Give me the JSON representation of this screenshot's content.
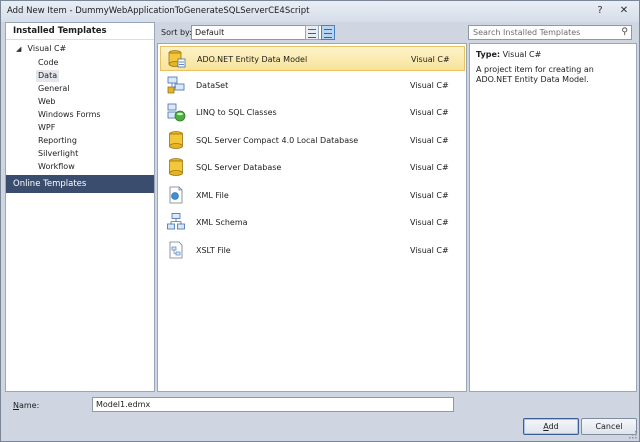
{
  "window": {
    "title": "Add New Item - DummyWebApplicationToGenerateSQLServerCE4Script",
    "help_glyph": "?",
    "close_glyph": "✕"
  },
  "left_panel": {
    "installed_header": "Installed Templates",
    "root": {
      "expander": "◢",
      "label": "Visual C#"
    },
    "children": [
      "Code",
      "Data",
      "General",
      "Web",
      "Windows Forms",
      "WPF",
      "Reporting",
      "Silverlight",
      "Workflow"
    ],
    "selected_child": "Data",
    "online_header": "Online Templates"
  },
  "toolbar": {
    "sort_label": "Sort by:",
    "sort_value": "Default",
    "search_placeholder": "Search Installed Templates",
    "search_icon": "search-icon"
  },
  "templates": [
    {
      "name": "ADO.NET Entity Data Model",
      "lang": "Visual C#",
      "icon": "entity-model-icon",
      "selected": true
    },
    {
      "name": "DataSet",
      "lang": "Visual C#",
      "icon": "dataset-icon"
    },
    {
      "name": "LINQ to SQL Classes",
      "lang": "Visual C#",
      "icon": "linq-icon"
    },
    {
      "name": "SQL Server Compact 4.0 Local Database",
      "lang": "Visual C#",
      "icon": "database-icon"
    },
    {
      "name": "SQL Server Database",
      "lang": "Visual C#",
      "icon": "database-icon"
    },
    {
      "name": "XML File",
      "lang": "Visual C#",
      "icon": "xml-file-icon"
    },
    {
      "name": "XML Schema",
      "lang": "Visual C#",
      "icon": "xml-schema-icon"
    },
    {
      "name": "XSLT File",
      "lang": "Visual C#",
      "icon": "xslt-file-icon"
    }
  ],
  "details": {
    "type_label": "Type:",
    "type_value": "Visual C#",
    "description": "A project item for creating an ADO.NET Entity Data Model."
  },
  "bottom": {
    "name_label_prefix": "N",
    "name_label_rest": "ame:",
    "name_value": "Model1.edmx",
    "add_prefix": "A",
    "add_rest": "dd",
    "cancel_label": "Cancel"
  },
  "colors": {
    "selected_row": "#f8e39a",
    "online_header_bg": "#3a4d6f",
    "dialog_bg": "#cfd6e2"
  }
}
